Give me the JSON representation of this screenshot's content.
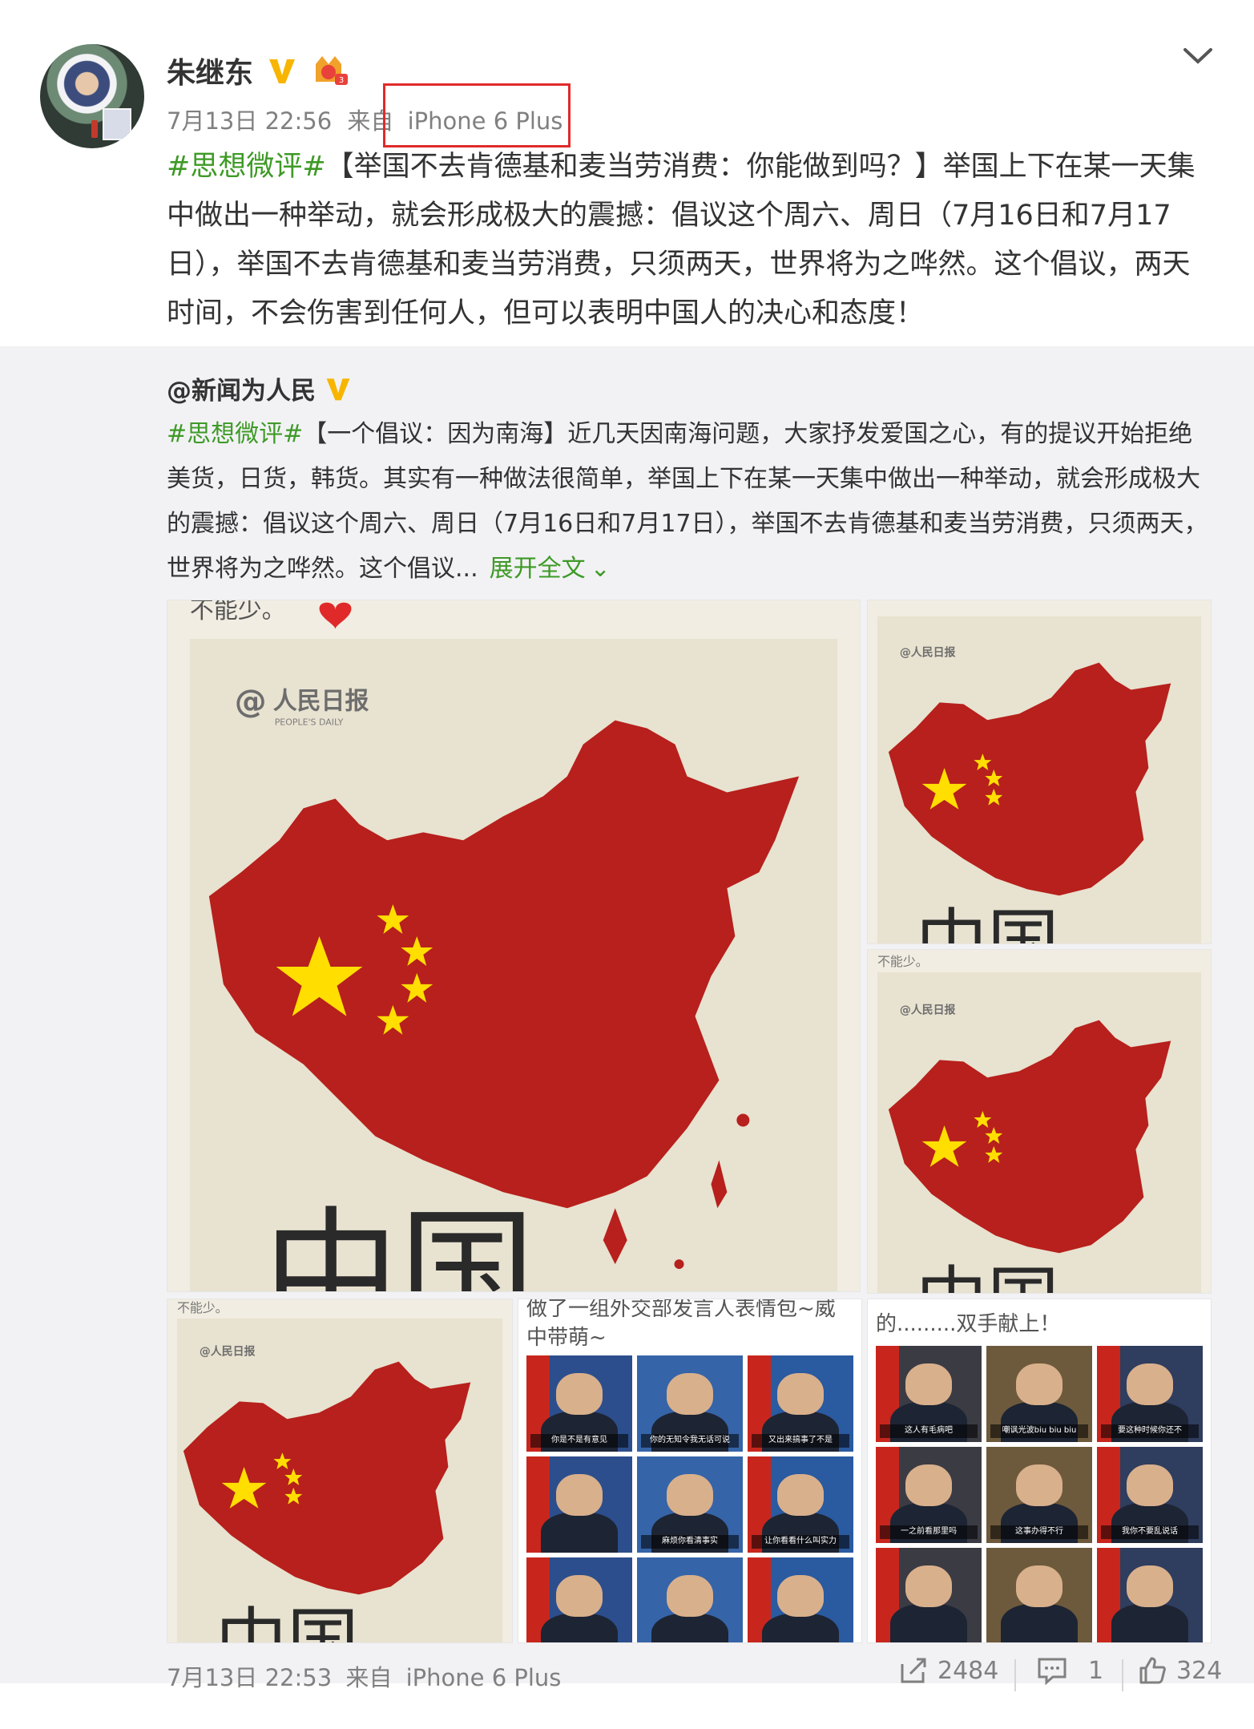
{
  "author": {
    "name": "朱继东",
    "verified_icon": "yellow-v-icon",
    "member_icon": "member-badge-icon"
  },
  "post": {
    "time": "7月13日 22:56",
    "from_label": "来自",
    "device": "iPhone 6 Plus",
    "hashtag": "#思想微评#",
    "body": "【举国不去肯德基和麦当劳消费：你能做到吗？】举国上下在某一天集中做出一种举动，就会形成极大的震撼：倡议这个周六、周日（7月16日和7月17日），举国不去肯德基和麦当劳消费，只须两天，世界将为之哗然。这个倡议，两天时间，不会伤害到任何人，但可以表明中国人的决心和态度！",
    "highlight_color": "#e02a2a"
  },
  "repost": {
    "author": "@新闻为人民",
    "hashtag": "#思想微评#",
    "body": "【一个倡议：因为南海】近几天因南海问题，大家抒发爱国之心，有的提议开始拒绝美货，日货，韩货。其实有一种做法很简单，举国上下在某一天集中做出一种举动，就会形成极大的震撼：倡议这个周六、周日（7月16日和7月17日），举国不去肯德基和麦当劳消费，只须两天，世界将为之哗然。这个倡议...",
    "expand_label": "展开全文",
    "images": {
      "caption_top": "不能少。",
      "logo_text": "人民日报",
      "logo_sub": "PEOPLE'S DAILY",
      "bottom_text": "中国",
      "caption_mid": "做了一组外交部发言人表情包~威中带萌~",
      "caption_right": "的.........双手献上！",
      "grid_subs_mid": [
        "你是不是有意见",
        "你的无知令我无话可说",
        "又出来搞事了不是",
        "",
        "麻烦你看清事实",
        "让你看看什么叫实力",
        "",
        "",
        ""
      ],
      "grid_subs_right": [
        "这人有毛病吧",
        "嘲讽光波biu biu biu",
        "要这种时候你还不",
        "一之前看那里吗",
        "这事办得不行",
        "我你不要乱说话",
        "",
        "",
        ""
      ]
    }
  },
  "footer": {
    "time": "7月13日 22:53",
    "from_label": "来自",
    "device": "iPhone 6 Plus",
    "shares": "2484",
    "comments": "1",
    "likes": "324"
  },
  "colors": {
    "hashtag_green": "#3e9a26",
    "meta_gray": "#808080",
    "repost_bg": "#f2f2f5",
    "flag_red": "#c8261d",
    "star_yellow": "#ffde00"
  }
}
